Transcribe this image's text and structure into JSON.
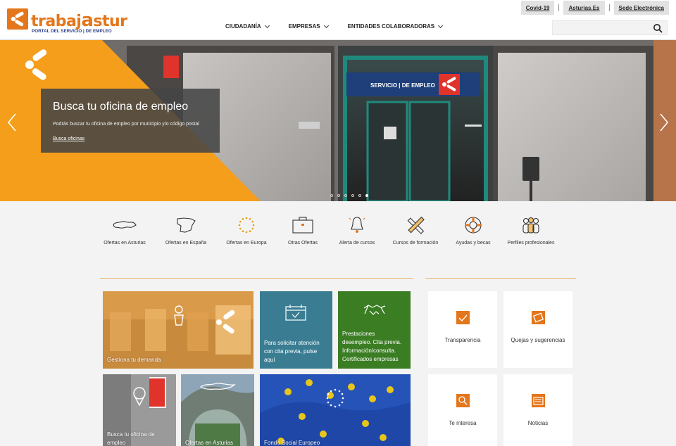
{
  "header": {
    "logo_name_a": "trabaj",
    "logo_name_b": "a",
    "logo_name_c": "stur",
    "logo_subtitle": "PORTAL DEL SERVICIO | DE EMPLEO",
    "top_links": [
      "Covid-19",
      "Asturias.Es",
      "Sede Electrónica"
    ],
    "nav": [
      "CIUDADANÍA",
      "EMPRESAS",
      "ENTIDADES COLABORADORAS"
    ],
    "search": {
      "placeholder": "",
      "value": ""
    }
  },
  "hero": {
    "title": "Busca tu oficina de empleo",
    "description": "Podrás buscar tu oficina de empleo por municipio y/o código postal",
    "link": "Busca oficinas",
    "sign_text": "SERVICIO | DE EMPLEO",
    "slides": 6,
    "active_slide": 6,
    "accent_color": "#f59e1c"
  },
  "quick_links": [
    {
      "label": "Ofertas en Asturias",
      "icon": "asturias-map-icon"
    },
    {
      "label": "Ofertas en España",
      "icon": "spain-map-icon"
    },
    {
      "label": "Ofertas en Europa",
      "icon": "eu-stars-icon"
    },
    {
      "label": "Otras Ofertas",
      "icon": "briefcase-icon"
    },
    {
      "label": "Alerta de cursos",
      "icon": "bell-icon"
    },
    {
      "label": "Cursos de formación",
      "icon": "pencil-ruler-icon"
    },
    {
      "label": "Ayudas y becas",
      "icon": "lifebuoy-icon"
    },
    {
      "label": "Perfiles profesionales",
      "icon": "people-icon"
    }
  ],
  "tiles": {
    "gestiona": "Gestiona tu demanda",
    "cita_previa": [
      "Para solicitar atención",
      "con cita previa, pulse",
      "aquí"
    ],
    "prestaciones": [
      "Prestaciones",
      "desempleo. Cita previa.",
      "Información/consulta.",
      "Certificados empresas"
    ],
    "busca_oficina": [
      "Busca tu oficina de",
      "empleo"
    ],
    "ofertas_asturias": "Ofertas en Asturias",
    "fondo_social": "Fondo Social Europeo"
  },
  "side_tiles": [
    {
      "label": "Transparencia",
      "icon": "transparency-icon"
    },
    {
      "label": "Quejas y sugerencias",
      "icon": "complaints-icon"
    },
    {
      "label": "Te interesa",
      "icon": "magnifier-icon"
    },
    {
      "label": "Noticias",
      "icon": "news-icon"
    }
  ],
  "colors": {
    "brand_orange": "#e4761b",
    "teal": "#3a7d93",
    "green": "#3b7d23",
    "eu_blue": "#1e47a8"
  }
}
